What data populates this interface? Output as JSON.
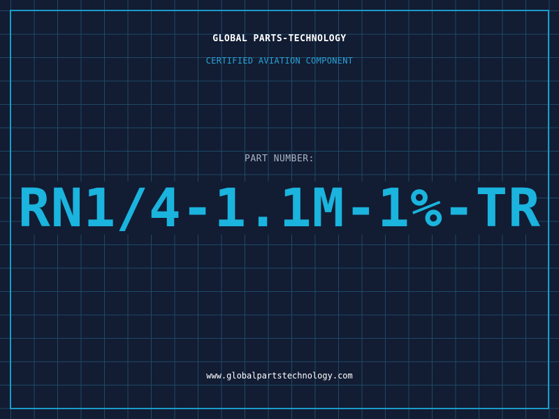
{
  "header": {
    "brand": "GLOBAL PARTS-TECHNOLOGY",
    "tagline": "CERTIFIED AVIATION COMPONENT"
  },
  "part": {
    "label": "PART NUMBER:",
    "number": "RN1/4-1.1M-1%-TR"
  },
  "footer": {
    "website": "www.globalpartstechnology.com"
  },
  "colors": {
    "background": "#121c33",
    "grid": "#1f4a66",
    "frame": "#1a9cc8",
    "accent": "#1ab4de",
    "tagline": "#2aa3d6",
    "label": "#aab4c4",
    "text": "#ffffff"
  }
}
